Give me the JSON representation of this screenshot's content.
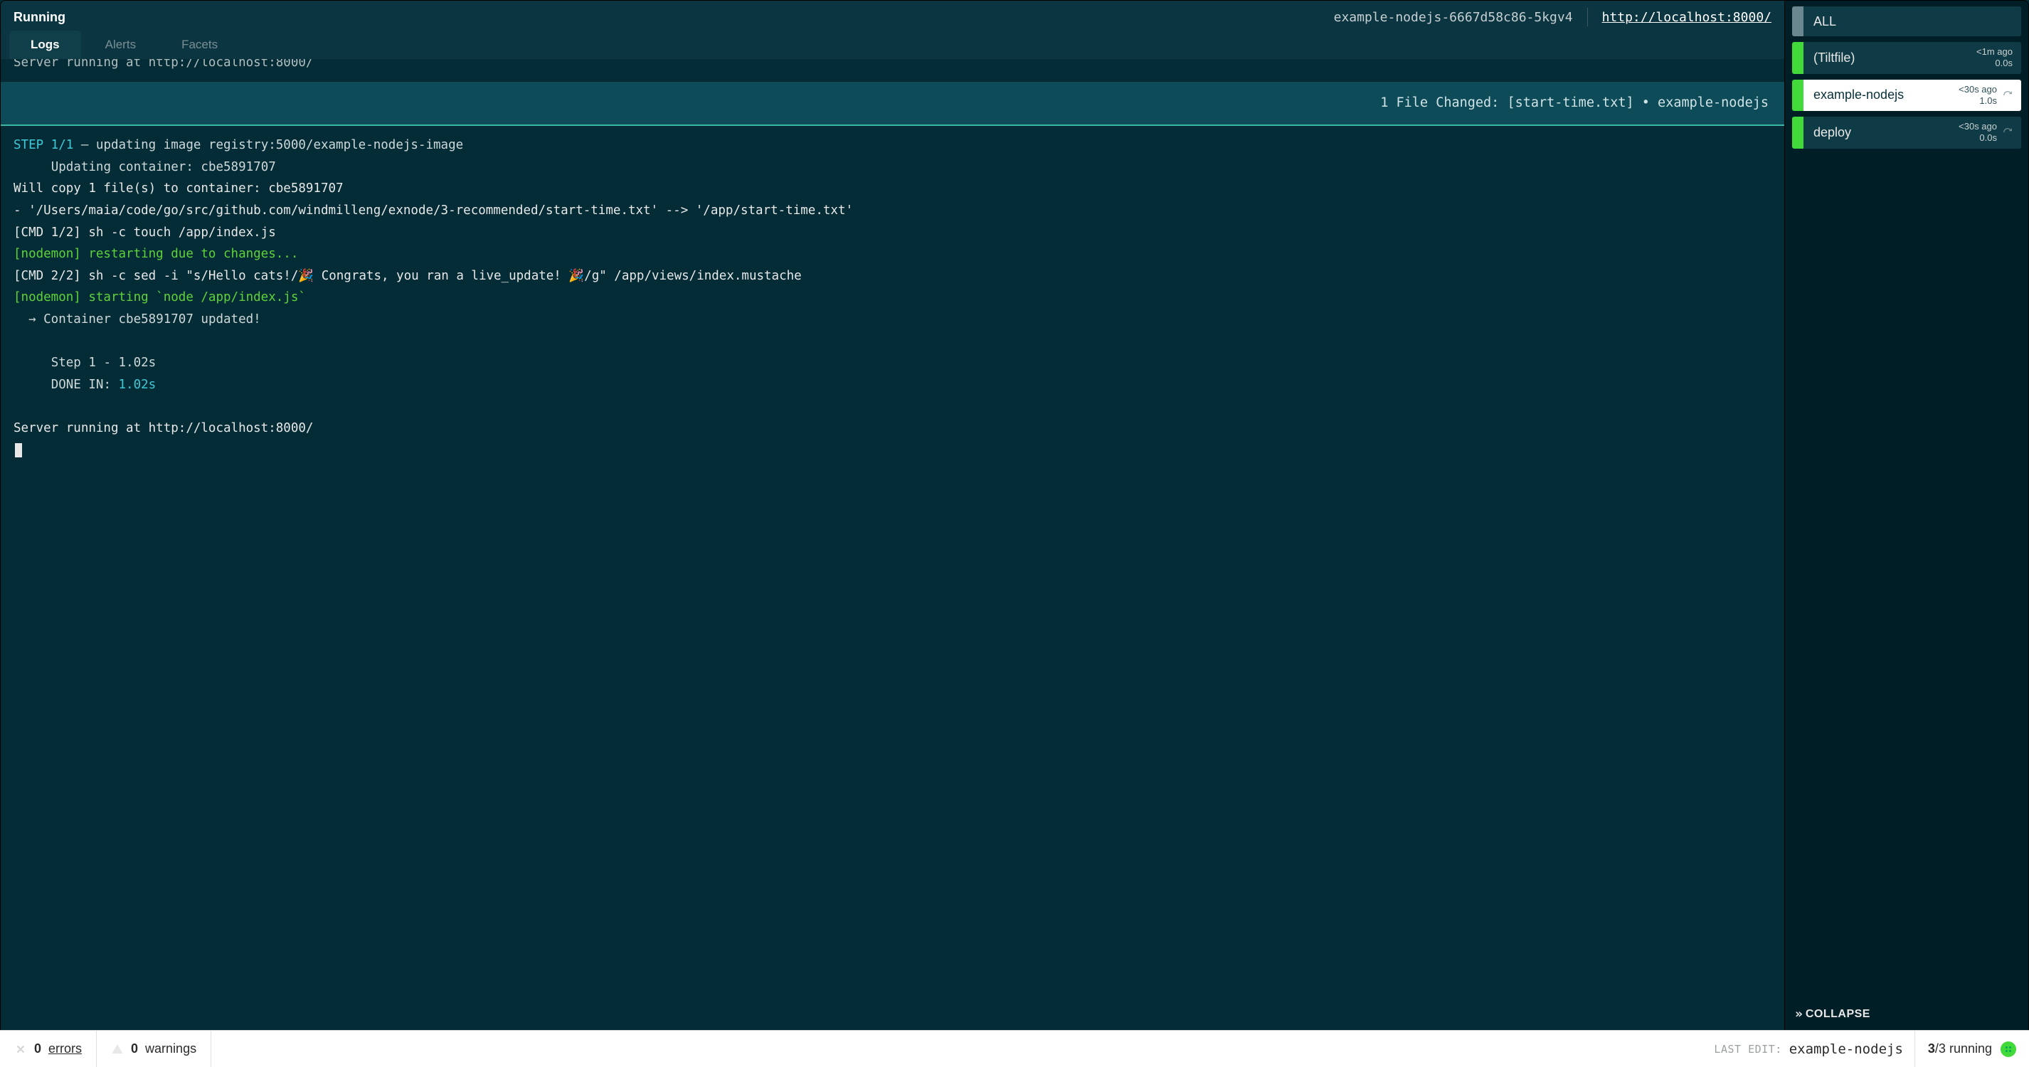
{
  "header": {
    "status": "Running",
    "pod_name": "example-nodejs-6667d58c86-5kgv4",
    "url": "http://localhost:8000/"
  },
  "tabs": [
    {
      "id": "logs",
      "label": "Logs",
      "active": true
    },
    {
      "id": "alerts",
      "label": "Alerts",
      "active": false
    },
    {
      "id": "facets",
      "label": "Facets",
      "active": false
    }
  ],
  "truncated_top_line": "Server running at http://localhost:8000/",
  "banner": "1 File Changed: [start-time.txt] • example-nodejs",
  "log_lines": [
    {
      "segments": [
        {
          "t": "STEP 1/1",
          "c": "cyan"
        },
        {
          "t": " — updating image registry:5000/example-nodejs-image",
          "c": "dim"
        }
      ]
    },
    {
      "segments": [
        {
          "t": "     Updating container: cbe5891707",
          "c": "dim"
        }
      ]
    },
    {
      "segments": [
        {
          "t": "Will copy 1 file(s) to container: cbe5891707",
          "c": "plain"
        }
      ]
    },
    {
      "segments": [
        {
          "t": "- '/Users/maia/code/go/src/github.com/windmilleng/exnode/3-recommended/start-time.txt' --> '/app/start-time.txt'",
          "c": "plain"
        }
      ]
    },
    {
      "segments": [
        {
          "t": "[CMD 1/2] sh -c touch /app/index.js",
          "c": "plain"
        }
      ]
    },
    {
      "segments": [
        {
          "t": "[nodemon] restarting due to changes...",
          "c": "green"
        }
      ]
    },
    {
      "segments": [
        {
          "t": "[CMD 2/2] sh -c sed -i \"s/Hello cats!/🎉 Congrats, you ran a live_update! 🎉/g\" /app/views/index.mustache",
          "c": "plain"
        }
      ]
    },
    {
      "segments": [
        {
          "t": "[nodemon] starting `node /app/index.js`",
          "c": "green"
        }
      ]
    },
    {
      "segments": [
        {
          "t": "  → Container cbe5891707 updated!",
          "c": "dim"
        }
      ]
    },
    {
      "segments": [
        {
          "t": " ",
          "c": "plain"
        }
      ]
    },
    {
      "segments": [
        {
          "t": "     Step 1 - 1.02s",
          "c": "dim"
        }
      ]
    },
    {
      "segments": [
        {
          "t": "     DONE IN: ",
          "c": "dim"
        },
        {
          "t": "1.02s",
          "c": "cyan"
        }
      ]
    },
    {
      "segments": [
        {
          "t": " ",
          "c": "plain"
        }
      ]
    },
    {
      "segments": [
        {
          "t": "Server running at http://localhost:8000/",
          "c": "plain"
        }
      ]
    }
  ],
  "sidebar": {
    "all_label": "ALL",
    "items": [
      {
        "name": "(Tiltfile)",
        "ago": "<1m ago",
        "dur": "0.0s",
        "active": false,
        "refresh": false
      },
      {
        "name": "example-nodejs",
        "ago": "<30s ago",
        "dur": "1.0s",
        "active": true,
        "refresh": true
      },
      {
        "name": "deploy",
        "ago": "<30s ago",
        "dur": "0.0s",
        "active": false,
        "refresh": true
      }
    ],
    "collapse_label": "COLLAPSE"
  },
  "statusbar": {
    "errors_count": "0",
    "errors_label": "errors",
    "warnings_count": "0",
    "warnings_label": "warnings",
    "last_edit_label": "LAST EDIT:",
    "last_edit_name": "example-nodejs",
    "running_done": "3",
    "running_total": "3",
    "running_label": "running"
  }
}
